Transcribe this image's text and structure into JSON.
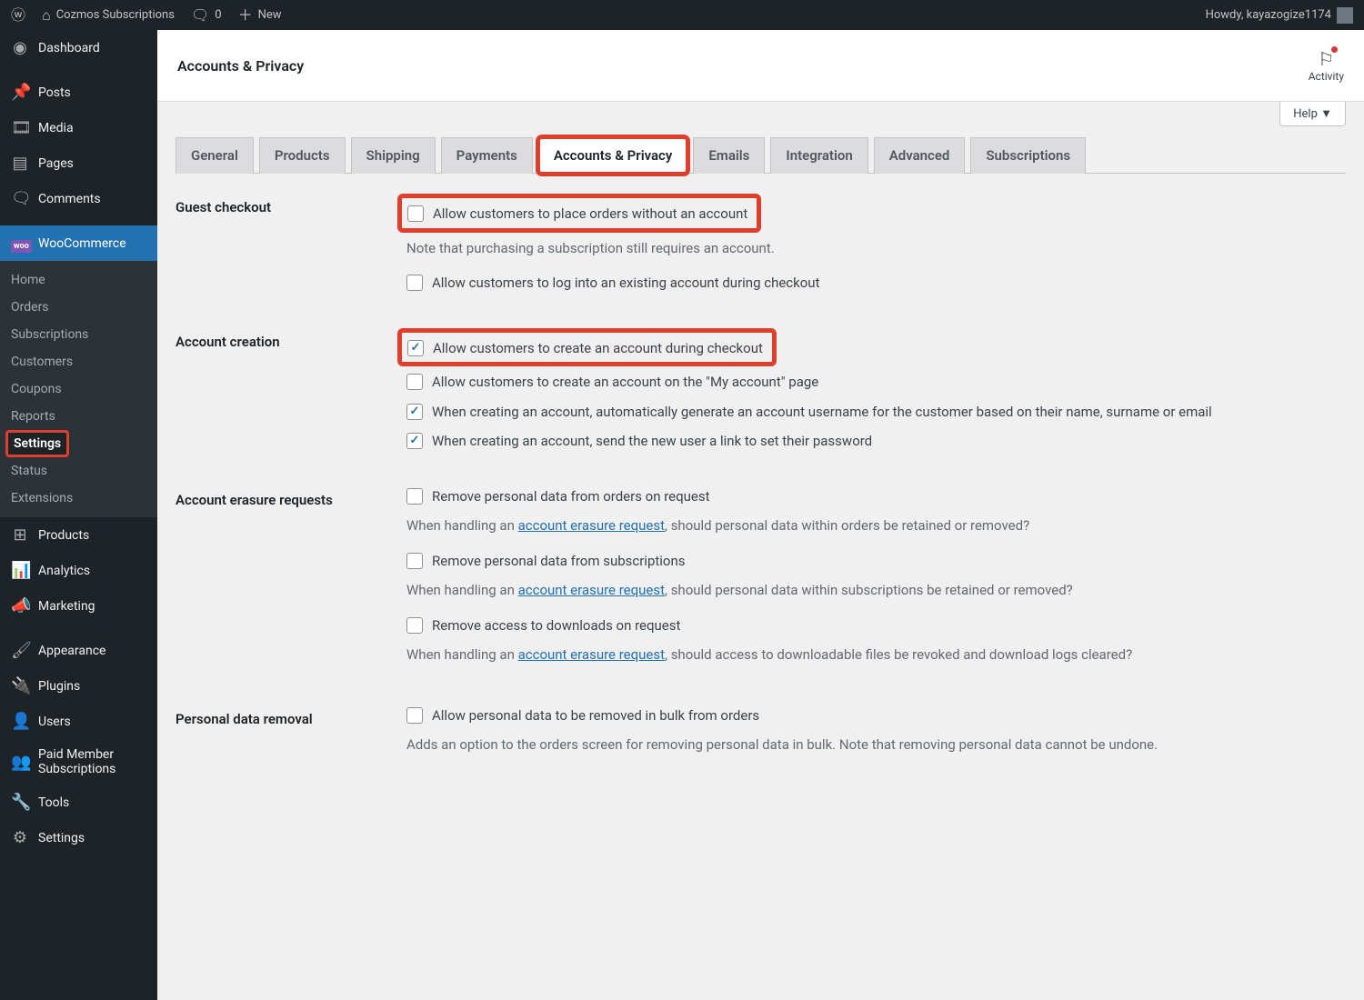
{
  "adminbar": {
    "site_name": "Cozmos Subscriptions",
    "comments": "0",
    "new": "New",
    "howdy": "Howdy, kayazogize1174"
  },
  "sidebar": {
    "dashboard": "Dashboard",
    "posts": "Posts",
    "media": "Media",
    "pages": "Pages",
    "comments": "Comments",
    "woocommerce": "WooCommerce",
    "sub_home": "Home",
    "sub_orders": "Orders",
    "sub_subscriptions": "Subscriptions",
    "sub_customers": "Customers",
    "sub_coupons": "Coupons",
    "sub_reports": "Reports",
    "sub_settings": "Settings",
    "sub_status": "Status",
    "sub_extensions": "Extensions",
    "products": "Products",
    "analytics": "Analytics",
    "marketing": "Marketing",
    "appearance": "Appearance",
    "plugins": "Plugins",
    "users": "Users",
    "paid_member": "Paid Member Subscriptions",
    "tools": "Tools",
    "settings": "Settings"
  },
  "header": {
    "title": "Accounts & Privacy",
    "activity": "Activity",
    "help": "Help ▼"
  },
  "tabs": {
    "general": "General",
    "products": "Products",
    "shipping": "Shipping",
    "payments": "Payments",
    "accounts": "Accounts & Privacy",
    "emails": "Emails",
    "integration": "Integration",
    "advanced": "Advanced",
    "subscriptions": "Subscriptions"
  },
  "sections": {
    "guest_checkout": {
      "label": "Guest checkout",
      "opt1": "Allow customers to place orders without an account",
      "note1": "Note that purchasing a subscription still requires an account.",
      "opt2": "Allow customers to log into an existing account during checkout"
    },
    "account_creation": {
      "label": "Account creation",
      "opt1": "Allow customers to create an account during checkout",
      "opt2": "Allow customers to create an account on the \"My account\" page",
      "opt3": "When creating an account, automatically generate an account username for the customer based on their name, surname or email",
      "opt4": "When creating an account, send the new user a link to set their password"
    },
    "erasure": {
      "label": "Account erasure requests",
      "opt1": "Remove personal data from orders on request",
      "note1a": "When handling an ",
      "link": "account erasure request",
      "note1b": ", should personal data within orders be retained or removed?",
      "opt2": "Remove personal data from subscriptions",
      "note2b": ", should personal data within subscriptions be retained or removed?",
      "opt3": "Remove access to downloads on request",
      "note3b": ", should access to downloadable files be revoked and download logs cleared?"
    },
    "removal": {
      "label": "Personal data removal",
      "opt1": "Allow personal data to be removed in bulk from orders",
      "note1": "Adds an option to the orders screen for removing personal data in bulk. Note that removing personal data cannot be undone."
    }
  }
}
